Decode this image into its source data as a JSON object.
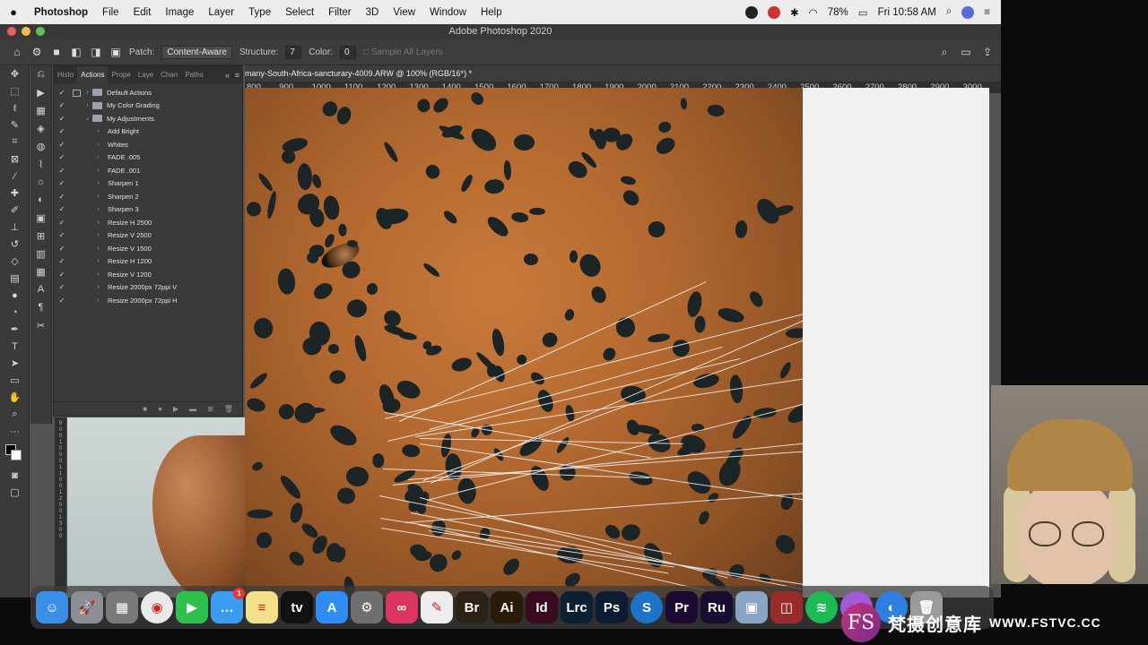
{
  "menubar": {
    "app_name": "Photoshop",
    "menus": [
      "File",
      "Edit",
      "Image",
      "Layer",
      "Type",
      "Select",
      "Filter",
      "3D",
      "View",
      "Window",
      "Help"
    ],
    "battery": "78%",
    "clock": "Fri 10:58 AM"
  },
  "window": {
    "title": "Adobe Photoshop 2020"
  },
  "options_bar": {
    "patch_label": "Patch:",
    "patch_value": "Content-Aware",
    "structure_label": "Structure:",
    "structure_value": "7",
    "color_label": "Color:",
    "color_value": "0",
    "sample_all_layers": "Sample All Layers"
  },
  "panel": {
    "tabs": [
      "Histo",
      "Actions",
      "Prope",
      "Laye",
      "Chan",
      "Paths"
    ],
    "active_tab": "Actions",
    "actions": [
      {
        "label": "Default Actions",
        "checked": true,
        "level": 0,
        "expanded": false,
        "dialog": true
      },
      {
        "label": "My Color Grading",
        "checked": true,
        "level": 0,
        "expanded": false,
        "dialog": false
      },
      {
        "label": "My Adjustments",
        "checked": true,
        "level": 0,
        "expanded": true,
        "dialog": false
      },
      {
        "label": "Add Bright",
        "checked": true,
        "level": 1
      },
      {
        "label": "Whites",
        "checked": true,
        "level": 1
      },
      {
        "label": "FADE .005",
        "checked": true,
        "level": 1
      },
      {
        "label": "FADE .001",
        "checked": true,
        "level": 1
      },
      {
        "label": "Sharpen 1",
        "checked": true,
        "level": 1
      },
      {
        "label": "Sharpen 2",
        "checked": true,
        "level": 1
      },
      {
        "label": "Sharpen 3",
        "checked": true,
        "level": 1
      },
      {
        "label": "Resize H 2500",
        "checked": true,
        "level": 1
      },
      {
        "label": "Resize V 2500",
        "checked": true,
        "level": 1
      },
      {
        "label": "Resize V 1500",
        "checked": true,
        "level": 1
      },
      {
        "label": "Resize H 1200",
        "checked": true,
        "level": 1
      },
      {
        "label": "Resize V 1200",
        "checked": true,
        "level": 1
      },
      {
        "label": "Resize 2000px 72ppi V",
        "checked": true,
        "level": 1
      },
      {
        "label": "Resize 2000px 72ppi H",
        "checked": true,
        "level": 1
      }
    ]
  },
  "document": {
    "tab_title": "many-South-Africa-sancturary-4009.ARW @ 100% (RGB/16*) *",
    "ruler_ticks": [
      "800",
      "900",
      "1000",
      "1100",
      "1200",
      "1300",
      "1400",
      "1500",
      "1600",
      "1700",
      "1800",
      "1900",
      "2000",
      "2100",
      "2200",
      "2300",
      "2400",
      "2500",
      "2600",
      "2700",
      "2800",
      "2900",
      "3000"
    ]
  },
  "dock": {
    "apps": [
      {
        "name": "Finder",
        "icon": "finder-icon",
        "color": "#3a8ee6",
        "glyph": "☺"
      },
      {
        "name": "Launchpad",
        "icon": "rocket-icon",
        "color": "#8a8f96",
        "glyph": "🚀"
      },
      {
        "name": "Calculator",
        "icon": "calculator-icon",
        "color": "#7a7a7a",
        "glyph": "▦"
      },
      {
        "name": "Chrome",
        "icon": "chrome-icon",
        "color": "#e9e9e9",
        "glyph": "◉"
      },
      {
        "name": "FaceTime",
        "icon": "facetime-icon",
        "color": "#2fbf4c",
        "glyph": "▶"
      },
      {
        "name": "Messages",
        "icon": "messages-icon",
        "color": "#3b9cf2",
        "glyph": "…",
        "badge": "1"
      },
      {
        "name": "Notes",
        "icon": "notes-icon",
        "color": "#f2e08a",
        "glyph": "≡"
      },
      {
        "name": "TV",
        "icon": "apple-tv-icon",
        "color": "#111111",
        "glyph": "tv"
      },
      {
        "name": "App Store",
        "icon": "app-store-icon",
        "color": "#2f8cf0",
        "glyph": "A"
      },
      {
        "name": "System Preferences",
        "icon": "gear-icon",
        "color": "#6f6f6f",
        "glyph": "⚙"
      },
      {
        "name": "Creative Cloud",
        "icon": "creative-cloud-icon",
        "color": "#d9355f",
        "glyph": "∞"
      },
      {
        "name": "Acrobat",
        "icon": "acrobat-icon",
        "color": "#ededed",
        "glyph": "✎"
      },
      {
        "name": "Bridge",
        "icon": "bridge-icon",
        "color": "#2a2214",
        "glyph": "Br"
      },
      {
        "name": "Illustrator",
        "icon": "illustrator-icon",
        "color": "#2b1a05",
        "glyph": "Ai"
      },
      {
        "name": "InDesign",
        "icon": "indesign-icon",
        "color": "#3a0a1e",
        "glyph": "Id"
      },
      {
        "name": "Lightroom Classic",
        "icon": "lightroom-icon",
        "color": "#0d1f33",
        "glyph": "Lrc"
      },
      {
        "name": "Photoshop",
        "icon": "photoshop-icon",
        "color": "#0b1c33",
        "glyph": "Ps"
      },
      {
        "name": "Skype",
        "icon": "skype-icon",
        "color": "#1b74c8",
        "glyph": "S"
      },
      {
        "name": "Premiere Pro",
        "icon": "premiere-icon",
        "color": "#1d0a33",
        "glyph": "Pr"
      },
      {
        "name": "Premiere Rush",
        "icon": "rush-icon",
        "color": "#1a0d33",
        "glyph": "Ru"
      },
      {
        "name": "Preview",
        "icon": "preview-icon",
        "color": "#8aa4c4",
        "glyph": "▣"
      },
      {
        "name": "Photo Booth",
        "icon": "photo-booth-icon",
        "color": "#9a2b2b",
        "glyph": "◫"
      },
      {
        "name": "Spotify",
        "icon": "spotify-icon",
        "color": "#1db954",
        "glyph": "≋"
      },
      {
        "name": "Podcasts",
        "icon": "podcast-icon",
        "color": "#a05ad9",
        "glyph": "◎"
      },
      {
        "name": "Safari",
        "icon": "safari-icon",
        "color": "#2f7fe0",
        "glyph": "◐"
      },
      {
        "name": "Trash",
        "icon": "trash-icon",
        "color": "#9a9a9a",
        "glyph": "🗑"
      }
    ]
  },
  "watermark": {
    "logo_text": "FS",
    "cn_text": "梵摄创意库",
    "url": "WWW.FSTVC.CC"
  }
}
